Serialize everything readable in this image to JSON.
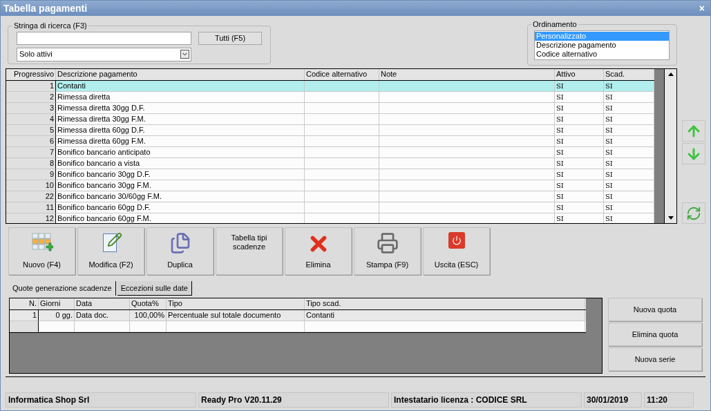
{
  "window": {
    "title": "Tabella pagamenti",
    "close": "×"
  },
  "search": {
    "legend": "Stringa di ricerca (F3)",
    "button": "Tutti (F5)",
    "filter": "Solo attivi"
  },
  "ordering": {
    "legend": "Ordinamento",
    "items": [
      {
        "label": "Personalizzato",
        "selected": true
      },
      {
        "label": "Descrizione pagamento",
        "selected": false
      },
      {
        "label": "Codice alternativo",
        "selected": false
      }
    ]
  },
  "table": {
    "columns": [
      "Progressivo",
      "Descrizione pagamento",
      "Codice alternativo",
      "Note",
      "Attivo",
      "Scad."
    ],
    "rows": [
      {
        "progressivo": "1",
        "descrizione": "Contanti",
        "attivo": "SI",
        "scad": "SI",
        "selected": true
      },
      {
        "progressivo": "2",
        "descrizione": "Rimessa diretta",
        "attivo": "SI",
        "scad": "SI",
        "selected": false
      },
      {
        "progressivo": "3",
        "descrizione": "Rimessa diretta 30gg D.F.",
        "attivo": "SI",
        "scad": "SI",
        "selected": false
      },
      {
        "progressivo": "4",
        "descrizione": "Rimessa diretta 30gg F.M.",
        "attivo": "SI",
        "scad": "SI",
        "selected": false
      },
      {
        "progressivo": "5",
        "descrizione": "Rimessa diretta 60gg D.F.",
        "attivo": "SI",
        "scad": "SI",
        "selected": false
      },
      {
        "progressivo": "6",
        "descrizione": "Rimessa diretta 60gg F.M.",
        "attivo": "SI",
        "scad": "SI",
        "selected": false
      },
      {
        "progressivo": "7",
        "descrizione": "Bonifico bancario anticipato",
        "attivo": "SI",
        "scad": "SI",
        "selected": false
      },
      {
        "progressivo": "8",
        "descrizione": "Bonifico bancario a vista",
        "attivo": "SI",
        "scad": "SI",
        "selected": false
      },
      {
        "progressivo": "9",
        "descrizione": "Bonifico bancario 30gg D.F.",
        "attivo": "SI",
        "scad": "SI",
        "selected": false
      },
      {
        "progressivo": "10",
        "descrizione": "Bonifico bancario 30gg F.M.",
        "attivo": "SI",
        "scad": "SI",
        "selected": false
      },
      {
        "progressivo": "22",
        "descrizione": "Bonifico bancario 30/60gg F.M.",
        "attivo": "SI",
        "scad": "SI",
        "selected": false
      },
      {
        "progressivo": "11",
        "descrizione": "Bonifico bancario 60gg D.F.",
        "attivo": "SI",
        "scad": "SI",
        "selected": false
      },
      {
        "progressivo": "12",
        "descrizione": "Bonifico bancario 60gg F.M.",
        "attivo": "SI",
        "scad": "SI",
        "selected": false
      }
    ]
  },
  "toolbar": [
    {
      "kind": "new",
      "label": "Nuovo (F4)"
    },
    {
      "kind": "edit",
      "label": "Modifica (F2)"
    },
    {
      "kind": "duplicate",
      "label": "Duplica"
    },
    {
      "kind": "text",
      "label": "Tabella tipi scadenze"
    },
    {
      "kind": "delete",
      "label": "Elimina"
    },
    {
      "kind": "print",
      "label": "Stampa (F9)"
    },
    {
      "kind": "exit",
      "label": "Uscita (ESC)"
    }
  ],
  "tabs": [
    {
      "label": "Quote generazione scadenze",
      "selected": true
    },
    {
      "label": "Eccezioni sulle date",
      "selected": false
    }
  ],
  "quote_table": {
    "columns": [
      "N.",
      "Giorni",
      "Data",
      "Quota%",
      "Tipo",
      "Tipo scad."
    ],
    "rows": [
      {
        "n": "1",
        "giorni": "0 gg.",
        "data": "Data doc.",
        "quota": "100,00%",
        "tipo": "Percentuale sul totale documento",
        "tipo_scad": "Contanti"
      }
    ]
  },
  "quote_buttons": [
    "Nuova quota",
    "Elimina quota",
    "Nuova serie"
  ],
  "status_bar": [
    "Informatica Shop Srl",
    "Ready Pro V20.11.29",
    "Intestatario licenza : CODICE SRL",
    "30/01/2019",
    "11:20"
  ]
}
